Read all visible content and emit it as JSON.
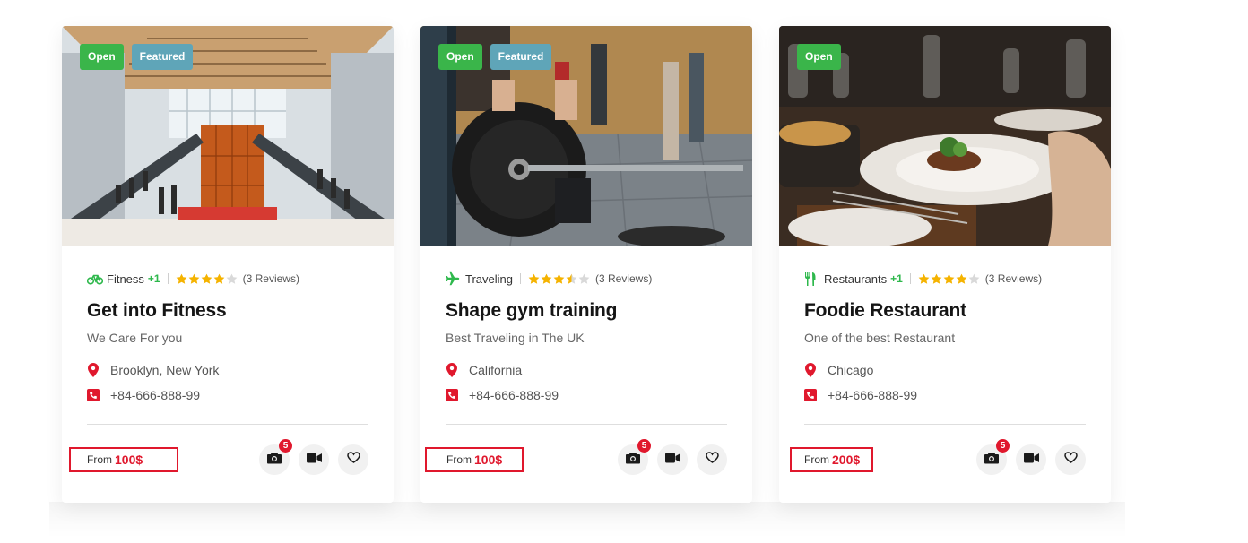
{
  "colors": {
    "accent": "#e0182d",
    "open_badge": "#3ab54a",
    "featured_badge": "#5fa5b8",
    "category_green": "#2eb84c",
    "star": "#f5b300",
    "star_empty": "#d9d9d9"
  },
  "cards": [
    {
      "image_name": "mall-lobby-escalators-image",
      "badges": [
        "Open",
        "Featured"
      ],
      "category": {
        "icon": "bicycle-icon",
        "label": "Fitness",
        "extra": "+1"
      },
      "rating": 4,
      "reviews": "(3 Reviews)",
      "title": "Get into Fitness",
      "subtitle": "We Care For you",
      "location": "Brooklyn, New York",
      "phone": "+84-666-888-99",
      "price_from": "From",
      "price_value": "100$",
      "photo_count": "5"
    },
    {
      "image_name": "gym-barbell-image",
      "badges": [
        "Open",
        "Featured"
      ],
      "category": {
        "icon": "plane-icon",
        "label": "Traveling",
        "extra": ""
      },
      "rating": 3.5,
      "reviews": "(3 Reviews)",
      "title": "Shape gym training",
      "subtitle": "Best Traveling in The UK",
      "location": "California",
      "phone": "+84-666-888-99",
      "price_from": "From",
      "price_value": "100$",
      "photo_count": "5"
    },
    {
      "image_name": "restaurant-dish-image",
      "badges": [
        "Open"
      ],
      "category": {
        "icon": "fork-knife-icon",
        "label": "Restaurants",
        "extra": "+1"
      },
      "rating": 4,
      "reviews": "(3 Reviews)",
      "title": "Foodie Restaurant",
      "subtitle": "One of the best Restaurant",
      "location": "Chicago",
      "phone": "+84-666-888-99",
      "price_from": "From",
      "price_value": "200$",
      "photo_count": "5"
    }
  ],
  "action_icons": [
    "camera-icon",
    "video-icon",
    "heart-icon"
  ]
}
